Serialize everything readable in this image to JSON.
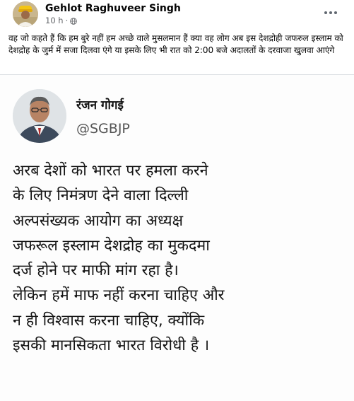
{
  "post": {
    "author": "Gehlot Raghuveer Singh",
    "time": "10 h",
    "separator": "·",
    "caption": "वह जो कहते हैं कि हम बुरे नहीं हम अच्छे वाले मुसलमान हैं क्या वह लोग अब इस देशद्रोही जफरुल इस्लाम को देशद्रोह के जुर्म में सजा दिलवा एंगे या इसके लिए भी रात को 2:00 बजे अदालतों के दरवाजा खुलवा आएंगे"
  },
  "tweet": {
    "name": "रंजन गोगई",
    "handle": "@SGBJP",
    "lines": [
      "अरब देशों को भारत पर हमला करने",
      "के लिए निमंत्रण देने वाला दिल्ली",
      "अल्पसंख्यक आयोग का अध्यक्ष",
      "जफरूल इस्लाम देशद्रोह का मुकदमा",
      "दर्ज होने पर माफी मांग रहा है।",
      "लेकिन हमें माफ नहीं करना चाहिए और",
      "न ही विश्वास करना चाहिए, क्योंकि",
      "इसकी मानसिकता भारत विरोधी है ।"
    ]
  },
  "icons": {
    "globe": "globe-icon",
    "more": "more-options-icon"
  }
}
